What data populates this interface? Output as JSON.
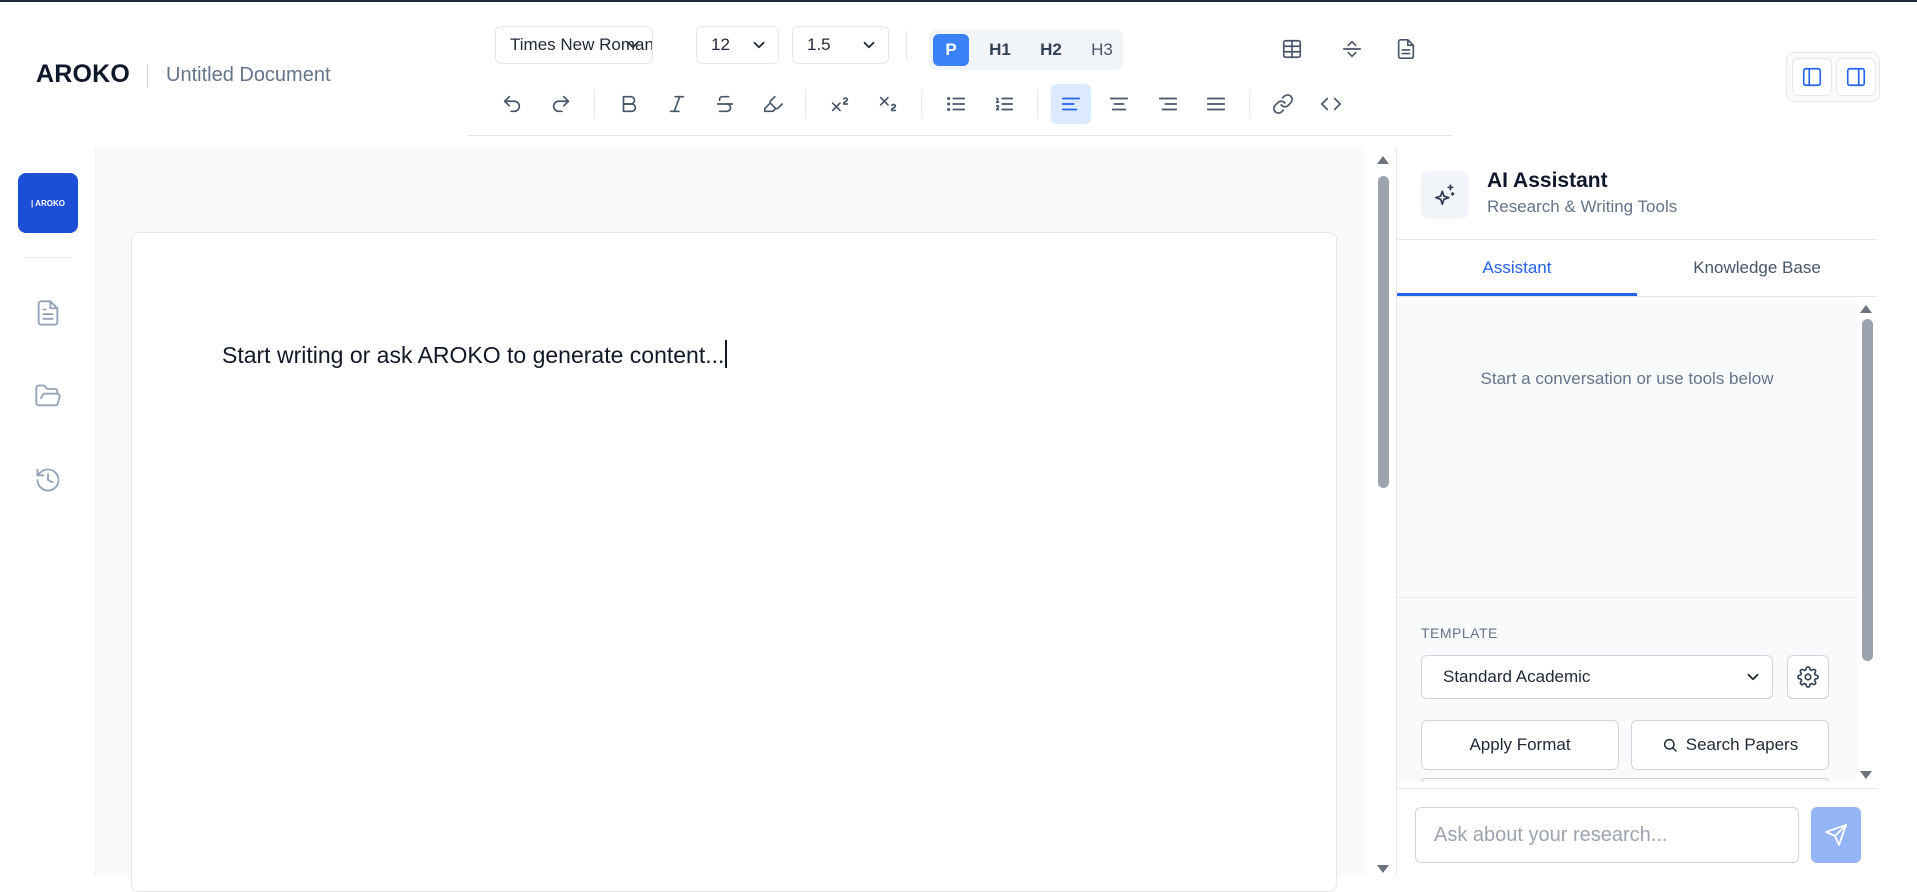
{
  "app": {
    "brand": "AROKO",
    "document_title": "Untitled Document",
    "logo_text": "| AROKO"
  },
  "toolbar": {
    "font_family": "Times New Roman",
    "font_size": "12",
    "line_height": "1.5",
    "headings": [
      "P",
      "H1",
      "H2",
      "H3"
    ],
    "active_heading": "P",
    "active_alignment": "align-left"
  },
  "editor": {
    "placeholder": "Start writing or ask AROKO to generate content..."
  },
  "assistant": {
    "title": "AI Assistant",
    "subtitle": "Research & Writing Tools",
    "tabs": [
      {
        "label": "Assistant",
        "active": true
      },
      {
        "label": "Knowledge Base",
        "active": false
      }
    ],
    "empty_state": "Start a conversation or use tools below",
    "template_label": "TEMPLATE",
    "template_value": "Standard Academic",
    "apply_label": "Apply Format",
    "search_label": "Search Papers",
    "input_placeholder": "Ask about your research..."
  },
  "colors": {
    "accent": "#2563eb",
    "accent_light": "#dbeafe",
    "send_button": "#93b4f5",
    "logo_bg": "#1d4ed8"
  },
  "icons": {
    "left_rail": [
      "document-icon",
      "folder-open-icon",
      "history-icon"
    ],
    "header_right": [
      "table-icon",
      "split-vertical-icon",
      "file-text-icon"
    ],
    "panel_toggle": [
      "left-panel-icon",
      "right-panel-icon"
    ]
  }
}
